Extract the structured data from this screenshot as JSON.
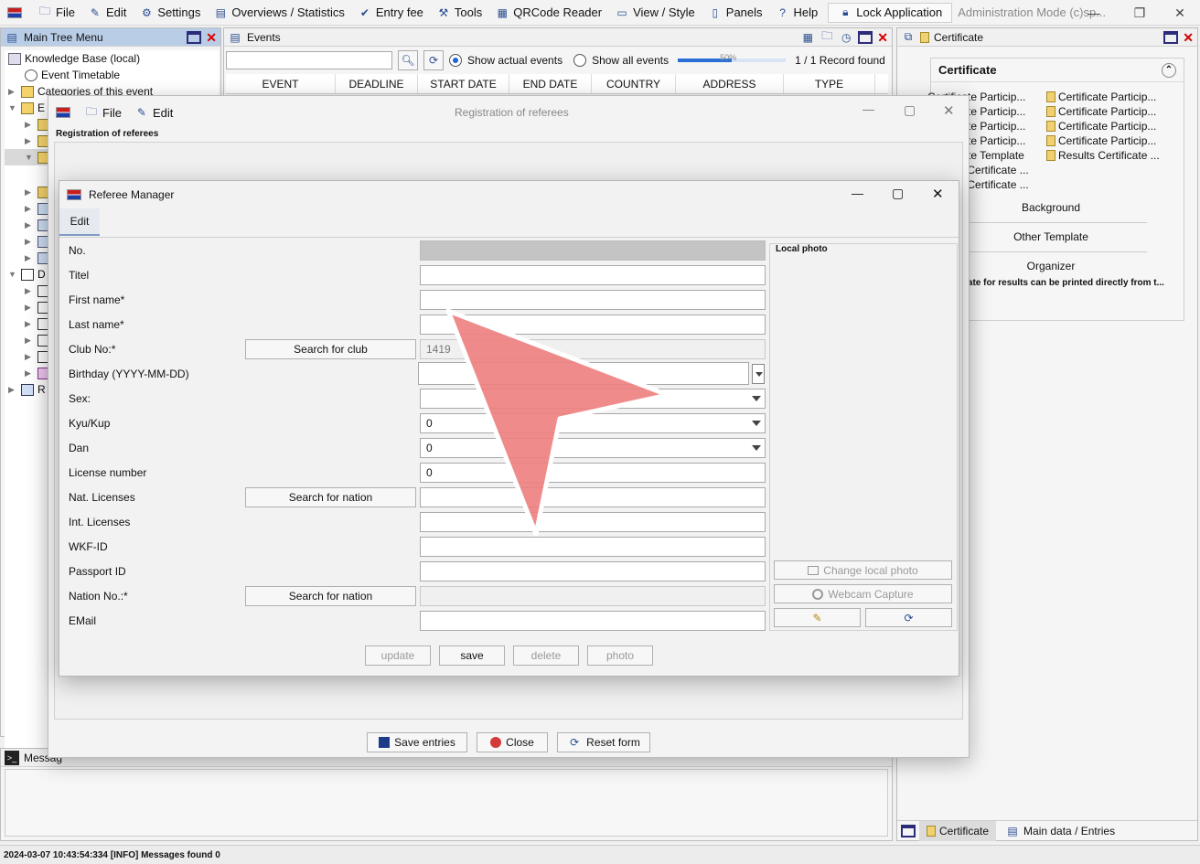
{
  "menubar": {
    "items": [
      "File",
      "Edit",
      "Settings",
      "Overviews / Statistics",
      "Entry fee",
      "Tools",
      "QRCode Reader",
      "View / Style",
      "Panels",
      "Help"
    ],
    "lock_label": "Lock Application",
    "admin_text": "Administration Mode (c)sp..."
  },
  "tree_panel": {
    "title": "Main Tree Menu",
    "rows": [
      "Knowledge Base (local)",
      "Event Timetable",
      "Categories of this event",
      "E",
      "",
      "",
      "",
      "",
      "",
      "",
      "",
      "",
      "D",
      "",
      "",
      "",
      "",
      "",
      "",
      "R"
    ]
  },
  "events_panel": {
    "title": "Events",
    "show_actual": "Show actual events",
    "show_all": "Show all events",
    "progress_label": "50%",
    "progress_fraction": 0.5,
    "record_text": "1 / 1 Record found",
    "columns": [
      "EVENT",
      "DEADLINE",
      "START DATE",
      "END DATE",
      "COUNTRY",
      "ADDRESS",
      "TYPE"
    ]
  },
  "certificate_panel": {
    "title": "Certificate",
    "heading": "Certificate",
    "items_left": [
      "Certificate Particip...",
      "Certificate Particip...",
      "Certificate Particip...",
      "Certificate Particip...",
      "Certificate Template",
      "Results Certificate ...",
      "Results Certificate ..."
    ],
    "items_right": [
      "Certificate Particip...",
      "Certificate Particip...",
      "Certificate Particip...",
      "Certificate Particip...",
      "Results Certificate ..."
    ],
    "sections": [
      "Background",
      "Other Template",
      "Organizer"
    ],
    "note": "...cate for results can be printed directly from t...",
    "bottom_tabs": [
      "Certificate",
      "Main data / Entries"
    ]
  },
  "message_panel": {
    "title": "Messag",
    "status_text": "2024-03-07 10:43:54:334 [INFO] Messages found 0"
  },
  "registration_dialog": {
    "app_menu": [
      "File",
      "Edit"
    ],
    "title": "Registration of referees",
    "subtitle": "Registration of referees",
    "footer": {
      "save": "Save entries",
      "close": "Close",
      "reset": "Reset form"
    }
  },
  "referee_dialog": {
    "title": "Referee Manager",
    "tab": "Edit",
    "labels": {
      "no": "No.",
      "titel": "Titel",
      "first_name": "First name*",
      "last_name": "Last name*",
      "club_no": "Club No:*",
      "birthday": "Birthday (YYYY-MM-DD)",
      "sex": "Sex:",
      "kyu": "Kyu/Kup",
      "dan": "Dan",
      "license": "License number",
      "nat_licenses": "Nat. Licenses",
      "int_licenses": "Int. Licenses",
      "wkf_id": "WKF-ID",
      "passport": "Passport ID",
      "nation_no": "Nation No.:*",
      "email": "EMail"
    },
    "values": {
      "club_no": "1419",
      "kyu": "0",
      "dan": "0",
      "license": "0"
    },
    "buttons": {
      "search_club": "Search for club",
      "search_nation_1": "Search for nation",
      "search_nation_2": "Search for nation",
      "update": "update",
      "save": "save",
      "delete": "delete",
      "photo": "photo"
    },
    "photo": {
      "label": "Local photo",
      "change": "Change local photo",
      "webcam": "Webcam Capture"
    }
  }
}
